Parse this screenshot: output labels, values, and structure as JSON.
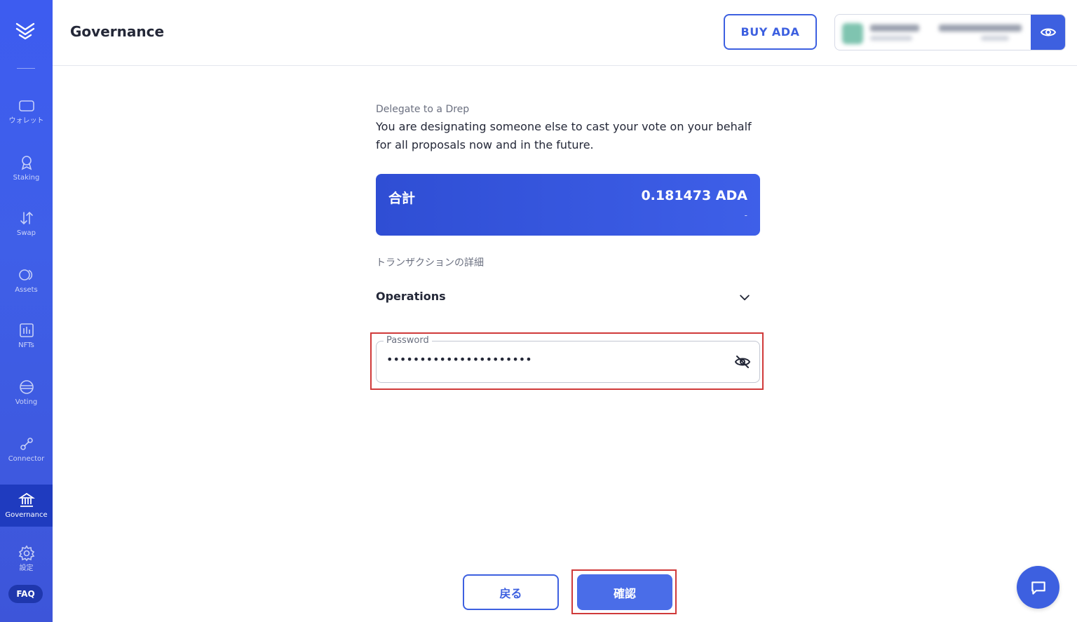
{
  "sidebar": {
    "logo_icon": "logo-chevrons-icon",
    "items": [
      {
        "label": "ウォレット",
        "icon": "wallet-icon"
      },
      {
        "label": "Staking",
        "icon": "staking-icon"
      },
      {
        "label": "Swap",
        "icon": "swap-icon"
      },
      {
        "label": "Assets",
        "icon": "assets-icon"
      },
      {
        "label": "NFTs",
        "icon": "nfts-icon"
      },
      {
        "label": "Voting",
        "icon": "voting-icon"
      },
      {
        "label": "Connector",
        "icon": "connector-icon"
      },
      {
        "label": "Governance",
        "icon": "governance-icon",
        "active": true
      },
      {
        "label": "設定",
        "icon": "settings-icon"
      }
    ],
    "faq_label": "FAQ"
  },
  "header": {
    "title": "Governance",
    "buy_label": "BUY ADA",
    "wallet_visibility_icon": "eye-icon"
  },
  "main": {
    "section_label": "Delegate to a Drep",
    "description": "You are designating someone else to cast your vote on your behalf for all proposals now and in the future.",
    "total": {
      "label": "合計",
      "value": "0.181473 ADA",
      "fiat": "-"
    },
    "tx_details_label": "トランザクションの詳細",
    "operations_label": "Operations",
    "password": {
      "label": "Password",
      "value": "••••••••••••••••••••••"
    },
    "back_label": "戻る",
    "confirm_label": "確認"
  },
  "colors": {
    "accent": "#3d60e0",
    "sidebar_active": "#1f3bbf",
    "highlight": "#d03a3a"
  }
}
